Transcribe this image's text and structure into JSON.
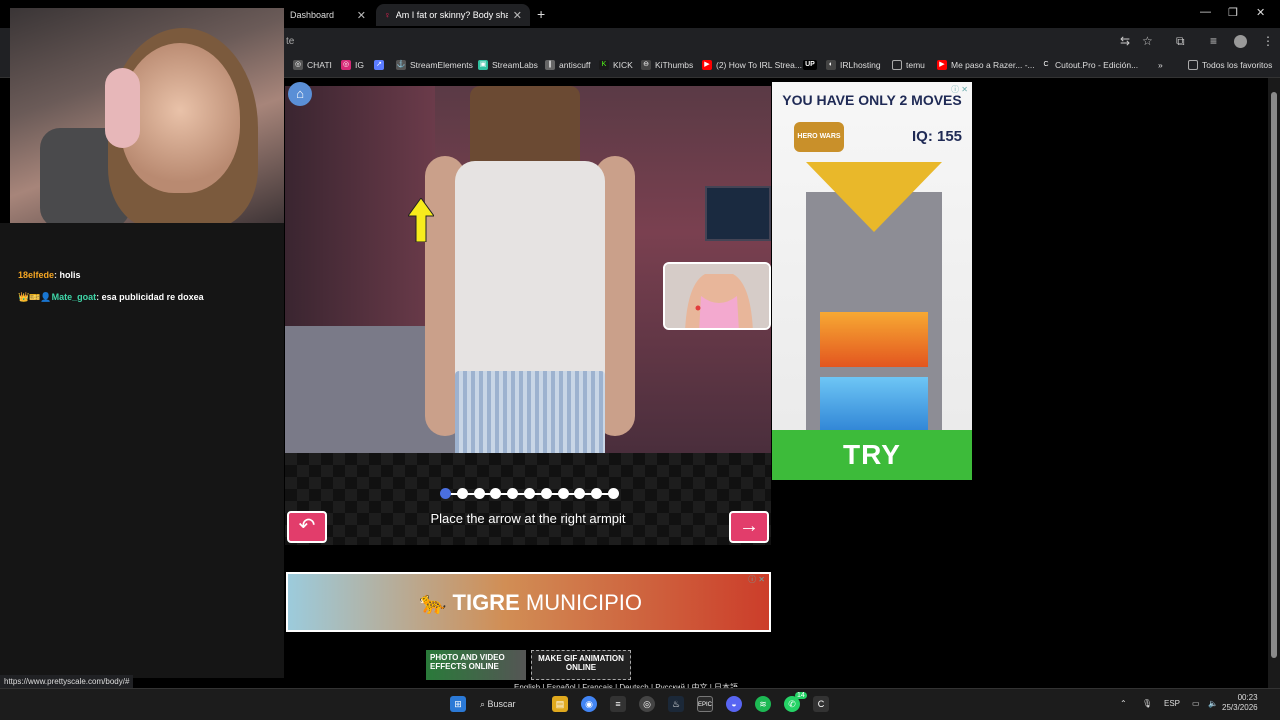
{
  "browser": {
    "tabs": [
      {
        "title": "Dashboard",
        "active": false
      },
      {
        "title": "Am I fat or skinny? Body shape",
        "active": true
      }
    ],
    "new_tab_symbol": "+",
    "url_fragment": "te",
    "window_controls": [
      "—",
      "❐",
      "✕"
    ],
    "bookmarks": [
      {
        "label": "CHATI",
        "icon": "instagram-icon",
        "color": "#d62976"
      },
      {
        "label": "IG",
        "icon": "instagram-icon",
        "color": "#d62976"
      },
      {
        "label": "",
        "icon": "chart-icon",
        "color": "#5b7cff"
      },
      {
        "label": "StreamElements",
        "icon": "streamelements-icon",
        "color": "#555555"
      },
      {
        "label": "StreamLabs",
        "icon": "streamlabs-icon",
        "color": "#31c3a2"
      },
      {
        "label": "antiscuff",
        "icon": "antiscuff-icon",
        "color": "#7a7a7a"
      },
      {
        "label": "KICK",
        "icon": "kick-icon",
        "color": "#53fc18"
      },
      {
        "label": "KiThumbs",
        "icon": "kithumbs-icon",
        "color": "#888888"
      },
      {
        "label": "(2) How To IRL Strea...",
        "icon": "youtube-icon",
        "color": "#ff0000"
      },
      {
        "label": "IRLhosting",
        "icon": "up-icon",
        "color": "#000000"
      },
      {
        "label": "temu",
        "icon": "folder-icon",
        "color": "#777777"
      },
      {
        "label": "Me paso a Razer... -...",
        "icon": "youtube-icon",
        "color": "#ff0000"
      },
      {
        "label": "Cutout.Pro - Edición...",
        "icon": "cutout-icon",
        "color": "#777777"
      }
    ],
    "bookmarks_more": "»",
    "all_bookmarks": "Todos los favoritos",
    "status_url": "https://www.prettyscale.com/body/#"
  },
  "stream_chat": [
    {
      "user": "18elfede",
      "user_color": "#f5a623",
      "message": "holis",
      "badges": ""
    },
    {
      "user": "Mate_goat",
      "user_color": "#3fd6a8",
      "message": "esa publicidad re doxea",
      "badges": "👑🎫👤"
    }
  ],
  "game": {
    "home_icon": "⌂",
    "progress": {
      "total_steps": 11,
      "current_step": 1
    },
    "instruction": "Place the arrow at the right armpit",
    "back_symbol": "↶",
    "next_symbol": "→"
  },
  "side_ad": {
    "headline": "YOU HAVE ONLY 2 MOVES",
    "brand": "HERO WARS",
    "iq": "IQ: 155",
    "cta": "TRY",
    "adchoices": "ⓘ ✕"
  },
  "banner_ad": {
    "brand_bold": "TIGRE",
    "brand_rest": " MUNICIPIO",
    "adchoices": "ⓘ ✕"
  },
  "footer_ads": [
    {
      "text": "PHOTO AND VIDEO EFFECTS ONLINE"
    },
    {
      "text": "MAKE GIF ANIMATION ONLINE"
    }
  ],
  "footer_links": "English | Español | Français | Deutsch | Русский | 中文 | 日本語",
  "taskbar": {
    "search_label": "Buscar",
    "language": "ESP",
    "time": "00:23",
    "date": "25/3/2026",
    "whatsapp_badge": "14"
  }
}
